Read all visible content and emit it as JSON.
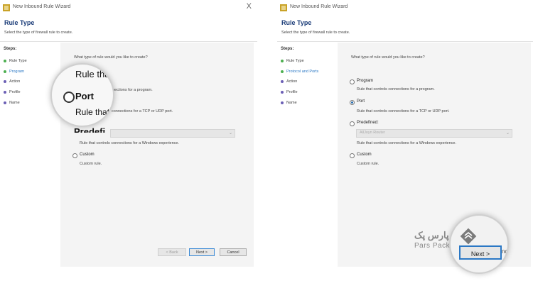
{
  "window": {
    "title": "New Inbound Rule Wizard",
    "close_symbol": "X",
    "heading": "Rule Type",
    "subheading": "Select the type of firewall rule to create."
  },
  "steps_label": "Steps:",
  "left_steps": [
    {
      "label": "Rule Type",
      "color": "#4caf50"
    },
    {
      "label": "Program",
      "color": "#4caf50"
    },
    {
      "label": "Action",
      "color": "#6b5fb5"
    },
    {
      "label": "Profile",
      "color": "#6b5fb5"
    },
    {
      "label": "Name",
      "color": "#6b5fb5"
    }
  ],
  "right_steps": [
    {
      "label": "Rule Type",
      "color": "#4caf50"
    },
    {
      "label": "Protocol and Ports",
      "color": "#4caf50"
    },
    {
      "label": "Action",
      "color": "#6b5fb5"
    },
    {
      "label": "Profile",
      "color": "#6b5fb5"
    },
    {
      "label": "Name",
      "color": "#6b5fb5"
    }
  ],
  "question": "What type of rule would you like to create?",
  "options": {
    "program": {
      "label": "Program",
      "desc": "Rule that controls connections for a program."
    },
    "port": {
      "label": "Port",
      "desc": "Rule that controls connections for a TCP or UDP port."
    },
    "predefined": {
      "label": "Predefined:",
      "value": "AllJoyn Router",
      "desc": "Rule that controls connections for a Windows experience."
    },
    "custom": {
      "label": "Custom",
      "desc": "Custom rule."
    }
  },
  "left_partial": {
    "program_desc": "onnections for a program.",
    "port_desc": "connections for a TCP or UDP port."
  },
  "buttons": {
    "back": "< Back",
    "next": "Next >",
    "cancel": "Cancel"
  },
  "magnifier_left": {
    "line1": "Rule that",
    "port": "Port",
    "line2": "Rule that co",
    "predef": "Predefi"
  },
  "magnifier_right": {
    "next": "Next >",
    "cancel": "ncel"
  },
  "logo": {
    "fa": "پارس پک",
    "en": "Pars Pack"
  },
  "accent": "#2b78c5"
}
